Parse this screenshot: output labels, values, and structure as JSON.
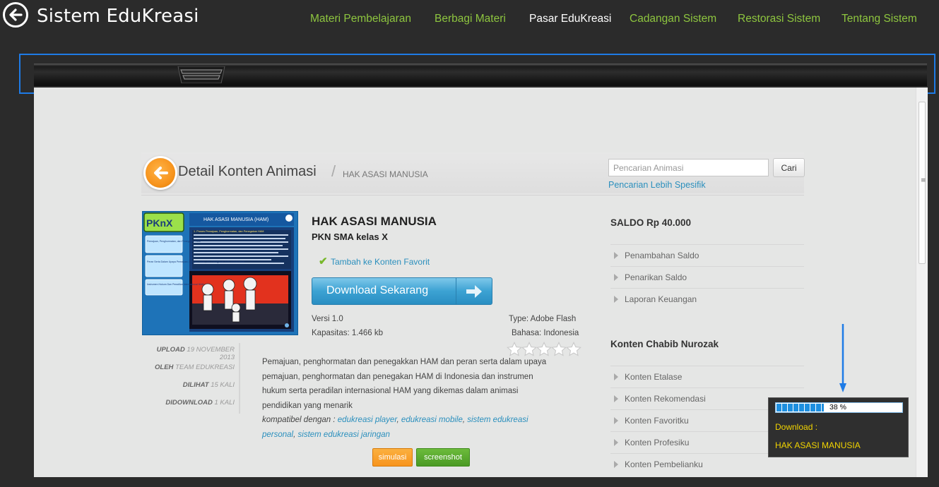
{
  "app": {
    "title": "Sistem EduKreasi",
    "nav": [
      {
        "label": "Materi Pembelajaran",
        "active": false
      },
      {
        "label": "Berbagi Materi",
        "active": false
      },
      {
        "label": "Pasar EduKreasi",
        "active": true
      },
      {
        "label": "Cadangan Sistem",
        "active": false
      },
      {
        "label": "Restorasi Sistem",
        "active": false
      },
      {
        "label": "Tentang Sistem",
        "active": false
      }
    ]
  },
  "page": {
    "title": "Detail Konten Animasi",
    "breadcrumb_sep": "/",
    "breadcrumb_current": "HAK ASASI MANUSIA",
    "search": {
      "placeholder": "Pencarian Animasi",
      "button": "Cari",
      "advanced_link": "Pencarian Lebih Spesifik"
    }
  },
  "thumbnail": {
    "logo": "PKnX",
    "title": "HAK ASASI MANUSIA (HAM)",
    "heading": "1. Proses Pemajuan, Penghormatan, dan Penegakan HAM",
    "menu": [
      "Pemajuan, Penghormatan, dan Penegakan HAM",
      "Peran Serta Dalam Upaya Pemajuan, Penghormatan, dan Penegakan HAM di Indonesia",
      "Instrumen Hukum Dan Peradilan Internasional HAM"
    ]
  },
  "meta": [
    {
      "key": "UPLOAD",
      "value": "19 NOVEMBER 2013"
    },
    {
      "key": "OLEH",
      "value": "TEAM EDUKREASI"
    },
    {
      "key": "DILIHAT",
      "value": "15 KALI"
    },
    {
      "key": "DIDOWNLOAD",
      "value": "1 KALI"
    }
  ],
  "product": {
    "title": "HAK ASASI MANUSIA",
    "subtitle": "PKN SMA kelas X",
    "favorite_link": "Tambah ke Konten Favorit",
    "download_button": "Download Sekarang",
    "version": "Versi 1.0",
    "capacity": "Kapasitas: 1.466 kb",
    "type": "Type: Adobe Flash",
    "language": "Bahasa: Indonesia",
    "rating": 0,
    "rating_max": 5,
    "description": "Pemajuan, penghormatan dan penegakkan HAM dan peran serta dalam upaya pemajuan, penghormatan dan penegakan HAM di Indonesia dan instrumen hukum serta peradilan internasional HAM yang dikemas dalam animasi pendidikan yang menarik",
    "compat_prefix": "kompatibel dengan :",
    "compat_links": [
      "edukreasi player",
      "edukreasi mobile",
      "sistem edukreasi personal",
      "sistem edukreasi jaringan"
    ],
    "sim_button": "simulasi",
    "screenshot_button": "screenshot"
  },
  "sidebar": {
    "balance": "SALDO Rp 40.000",
    "balance_items": [
      "Penambahan Saldo",
      "Penarikan Saldo",
      "Laporan Keuangan"
    ],
    "content_heading": "Konten Chabib Nurozak",
    "content_items": [
      "Konten Etalase",
      "Konten Rekomendasi",
      "Konten Favoritku",
      "Konten Profesiku",
      "Konten Pembelianku"
    ]
  },
  "download_toast": {
    "progress": 0.38,
    "progress_text": "38 %",
    "label": "Download :",
    "file": "HAK ASASI MANUSIA"
  },
  "colors": {
    "nav": "#8ec63f",
    "link": "#2a8fbd",
    "accent_orange": "#f7941d",
    "highlight_frame": "#1e7be6",
    "toast_text": "#f2d400"
  }
}
